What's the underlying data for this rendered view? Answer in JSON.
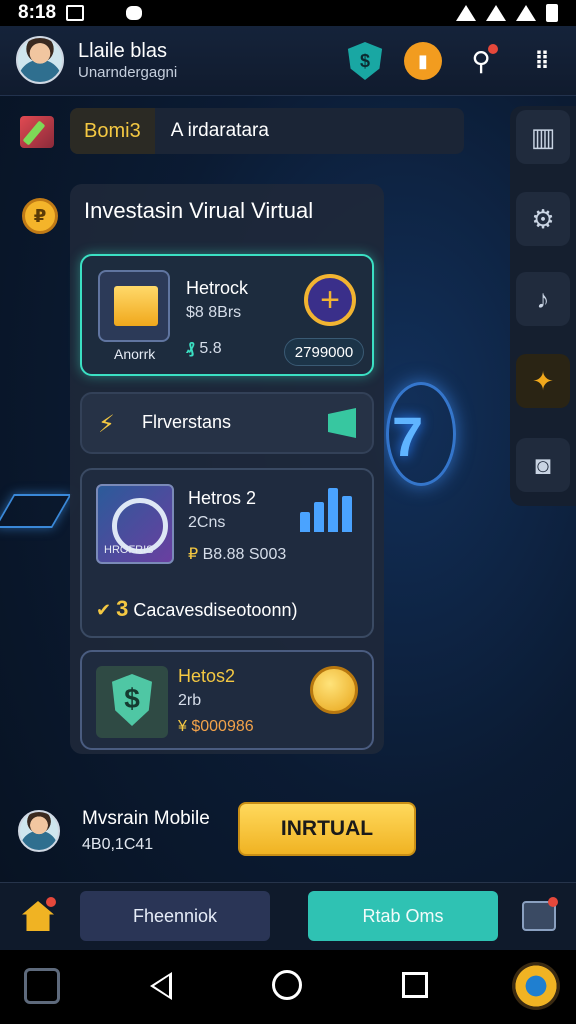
{
  "status_bar": {
    "time": "8:18"
  },
  "header": {
    "user_name": "Llaile blas",
    "user_subtitle": "Unarndergagni",
    "notification_count": "1"
  },
  "top_bar": {
    "chip_label": "Bomi3",
    "text": "A irdaratara"
  },
  "panel": {
    "title": "Investasin Virual Virtual",
    "card1": {
      "icon_caption": "Anorrk",
      "title": "Hetrock",
      "price": "$8 8Brs",
      "stat": "5.8",
      "pill": "2799000"
    },
    "card2": {
      "label": "Flrverstans"
    },
    "card3": {
      "title": "Hetros 2",
      "subtitle": "2Cns",
      "value": "B8.88 S003",
      "icon_caption": "HROFRIS",
      "footer_number": "3",
      "footer_text": "Cacavesdiseotoonn)"
    },
    "card4": {
      "title": "Hetos2",
      "subtitle": "2rb",
      "value": "$000986"
    }
  },
  "bottom_user": {
    "name": "Mvsrain Mobile",
    "number": "4B0,1C41",
    "action_label": "INRTUAL"
  },
  "action_bar": {
    "left_button": "Fheenniok",
    "right_button": "Rtab Oms"
  },
  "colors": {
    "accent_gold": "#f0b323",
    "accent_teal": "#3be0c3",
    "background": "#0b1b33"
  }
}
